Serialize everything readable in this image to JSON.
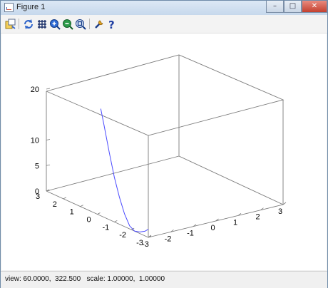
{
  "window": {
    "title": "Figure 1",
    "controls": {
      "minimize": "–",
      "maximize": "□",
      "close": "✕"
    }
  },
  "toolbar": {
    "buttons": [
      {
        "name": "copy-figure-icon"
      },
      {
        "name": "replot-icon"
      },
      {
        "name": "grid-icon"
      },
      {
        "name": "zoom-in-icon"
      },
      {
        "name": "zoom-out-icon"
      },
      {
        "name": "autoscale-icon"
      },
      {
        "name": "settings-wrench-icon"
      },
      {
        "name": "help-icon"
      }
    ]
  },
  "status": {
    "text": "view: 60.0000,  322.500   scale: 1.00000,  1.00000"
  },
  "chart_data": {
    "type": "surface3d",
    "view": [
      60.0,
      322.5
    ],
    "scale": [
      1.0,
      1.0
    ],
    "xlim": [
      -3,
      3
    ],
    "ylim": [
      -3,
      3
    ],
    "zlim": [
      0,
      20
    ],
    "x_ticks": [
      "-3",
      "-2",
      "-1",
      "0",
      "1",
      "2",
      "3"
    ],
    "y_ticks": [
      "-3",
      "-2",
      "-1",
      "0",
      "1",
      "2",
      "3"
    ],
    "z_ticks": [
      "0",
      "5",
      "10",
      "20"
    ],
    "series": [
      {
        "color": "#4b4bff",
        "points": [
          {
            "x": -3,
            "y": -3,
            "z": 1.6
          },
          {
            "x": -3,
            "y": -2.8,
            "z": 0.9
          },
          {
            "x": -3,
            "y": -2.5,
            "z": 0.3
          },
          {
            "x": -3,
            "y": -2.2,
            "z": 0.0
          },
          {
            "x": -3,
            "y": -1.9,
            "z": 0.6
          },
          {
            "x": -3,
            "y": -1.6,
            "z": 2.5
          },
          {
            "x": -3,
            "y": -1.3,
            "z": 5.3
          },
          {
            "x": -3,
            "y": -1.0,
            "z": 8.8
          },
          {
            "x": -3,
            "y": -0.7,
            "z": 13.2
          },
          {
            "x": -3,
            "y": -0.4,
            "z": 18.0
          },
          {
            "x": -3,
            "y": -0.2,
            "z": 21.0
          }
        ]
      }
    ],
    "grid": false
  }
}
